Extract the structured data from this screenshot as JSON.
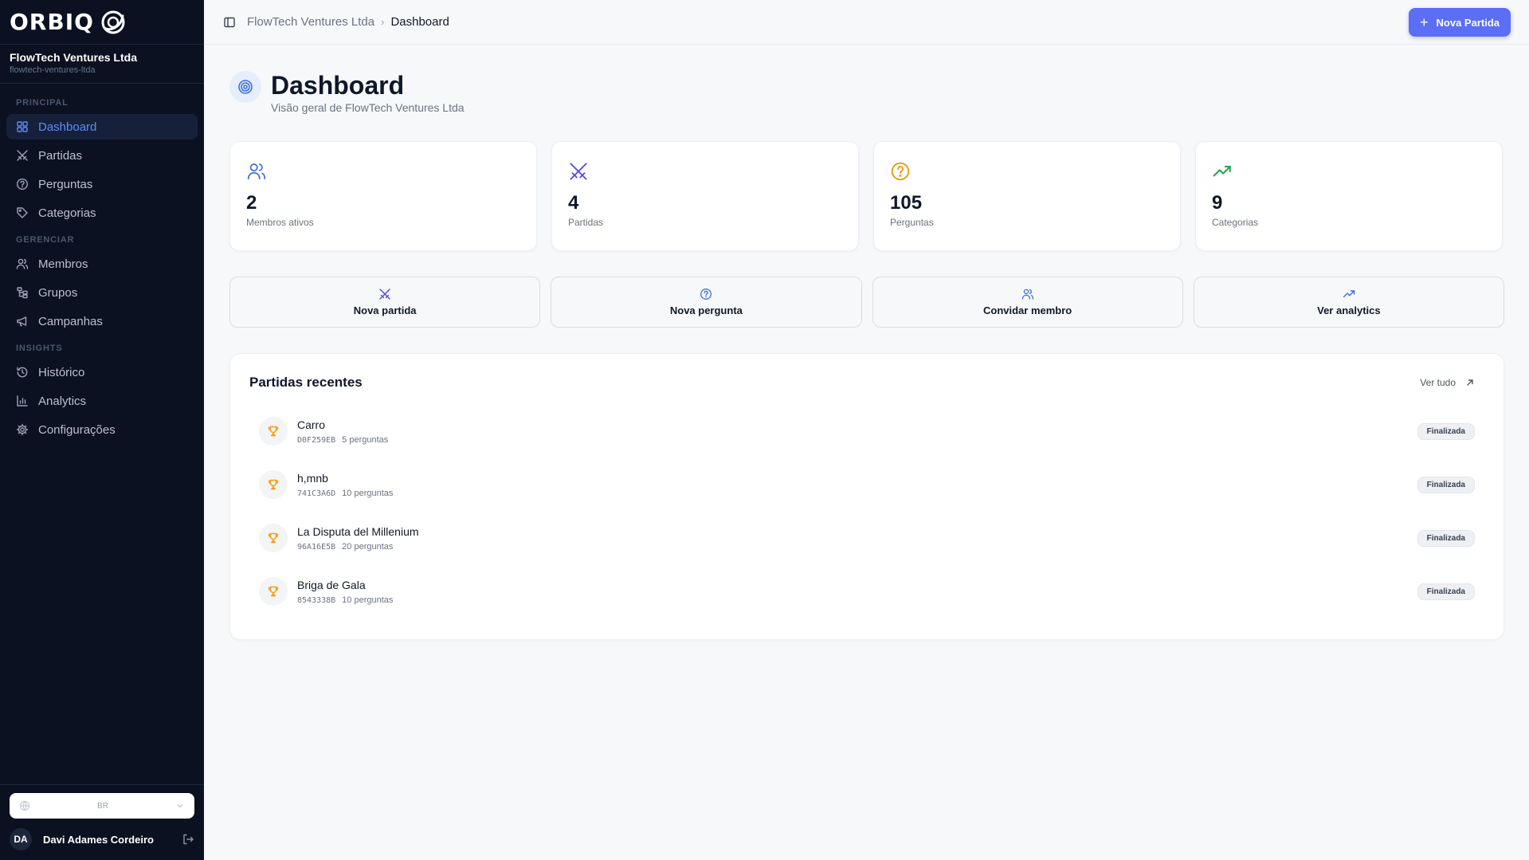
{
  "brand": {
    "name": "ORBIQ"
  },
  "org": {
    "name": "FlowTech Ventures Ltda",
    "slug": "flowtech-ventures-ltda"
  },
  "sidebar": {
    "sections": [
      {
        "title": "PRINCIPAL",
        "items": [
          {
            "label": "Dashboard",
            "icon": "grid-icon",
            "active": true
          },
          {
            "label": "Partidas",
            "icon": "swords-icon"
          },
          {
            "label": "Perguntas",
            "icon": "question-circle-icon"
          },
          {
            "label": "Categorias",
            "icon": "tag-icon"
          }
        ]
      },
      {
        "title": "GERENCIAR",
        "items": [
          {
            "label": "Membros",
            "icon": "users-icon"
          },
          {
            "label": "Grupos",
            "icon": "hierarchy-icon"
          },
          {
            "label": "Campanhas",
            "icon": "megaphone-icon"
          }
        ]
      },
      {
        "title": "INSIGHTS",
        "items": [
          {
            "label": "Histórico",
            "icon": "history-icon"
          },
          {
            "label": "Analytics",
            "icon": "bar-chart-icon"
          },
          {
            "label": "Configurações",
            "icon": "gear-icon"
          }
        ]
      }
    ],
    "language": {
      "value": "BR"
    },
    "user": {
      "initials": "DA",
      "name": "Davi Adames Cordeiro"
    }
  },
  "topbar": {
    "breadcrumb_org": "FlowTech Ventures Ltda",
    "breadcrumb_sep": "›",
    "breadcrumb_current": "Dashboard",
    "new_button": "Nova Partida"
  },
  "page": {
    "title": "Dashboard",
    "subtitle": "Visão geral de FlowTech Ventures Ltda"
  },
  "stats": [
    {
      "value": "2",
      "label": "Membros ativos",
      "icon": "users-icon",
      "color": "#3b6fe0"
    },
    {
      "value": "4",
      "label": "Partidas",
      "icon": "swords-icon",
      "color": "#5046e5"
    },
    {
      "value": "105",
      "label": "Perguntas",
      "icon": "question-circle-icon",
      "color": "#e39b0c"
    },
    {
      "value": "9",
      "label": "Categorias",
      "icon": "trending-up-icon",
      "color": "#16a34a"
    }
  ],
  "quick_actions": [
    {
      "label": "Nova partida",
      "icon": "swords-icon"
    },
    {
      "label": "Nova pergunta",
      "icon": "question-circle-icon"
    },
    {
      "label": "Convidar membro",
      "icon": "users-icon"
    },
    {
      "label": "Ver analytics",
      "icon": "trending-up-icon"
    }
  ],
  "recent": {
    "title": "Partidas recentes",
    "see_all": "Ver tudo",
    "rows": [
      {
        "name": "Carro",
        "code": "D0F259EB",
        "count": "5 perguntas",
        "status": "Finalizada"
      },
      {
        "name": "h,mnb",
        "code": "741C3A6D",
        "count": "10 perguntas",
        "status": "Finalizada"
      },
      {
        "name": "La Disputa del Millenium",
        "code": "96A16E5B",
        "count": "20 perguntas",
        "status": "Finalizada"
      },
      {
        "name": "Briga de Gala",
        "code": "8543338B",
        "count": "10 perguntas",
        "status": "Finalizada"
      }
    ]
  },
  "colors": {
    "accent": "#5b6ef5",
    "sidebar_bg": "#0b1121",
    "active_nav": "#5b8df7",
    "trophy": "#f59e0b"
  }
}
